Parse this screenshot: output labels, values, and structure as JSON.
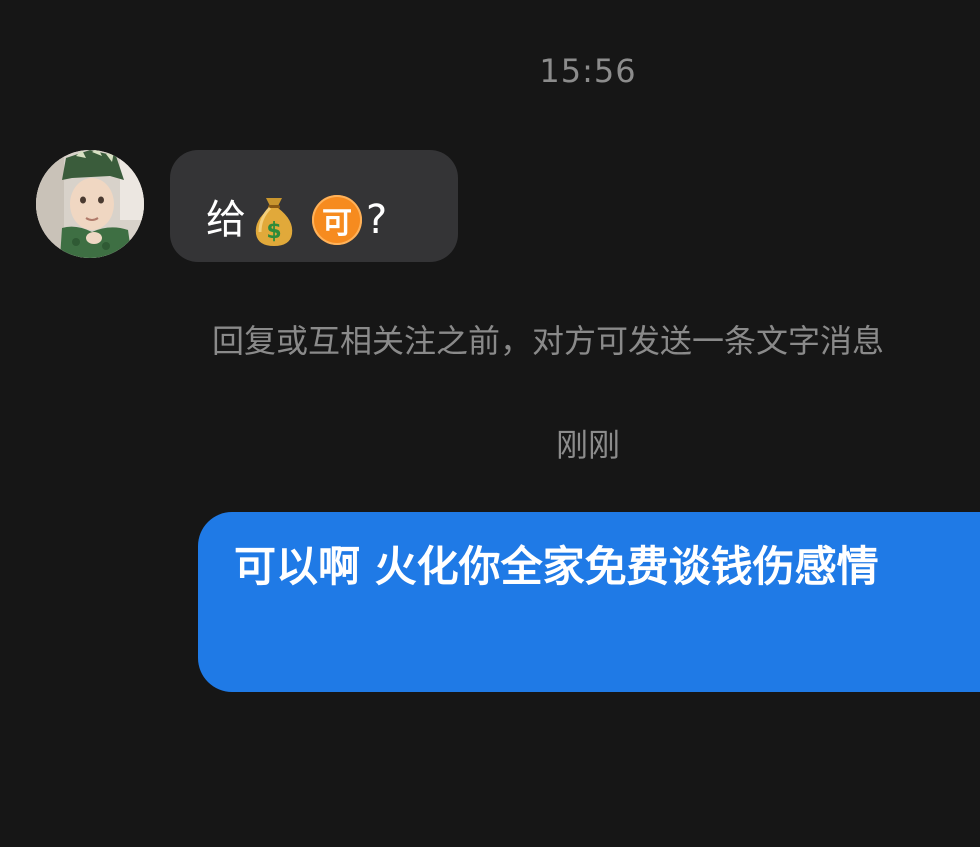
{
  "chat": {
    "timestamp_top": "15:56",
    "incoming": {
      "text_before": "给",
      "money_icon": "money-bag-icon",
      "badge_text": "可",
      "text_after": "?"
    },
    "notice": "回复或互相关注之前，对方可发送一条文字消息",
    "timestamp_recent": "刚刚",
    "outgoing": {
      "text": "可以啊 火化你全家免费谈钱伤感情"
    }
  },
  "colors": {
    "background": "#161616",
    "incoming_bubble": "#343436",
    "outgoing_bubble": "#1f7ae6",
    "badge": "#f68b1f"
  }
}
